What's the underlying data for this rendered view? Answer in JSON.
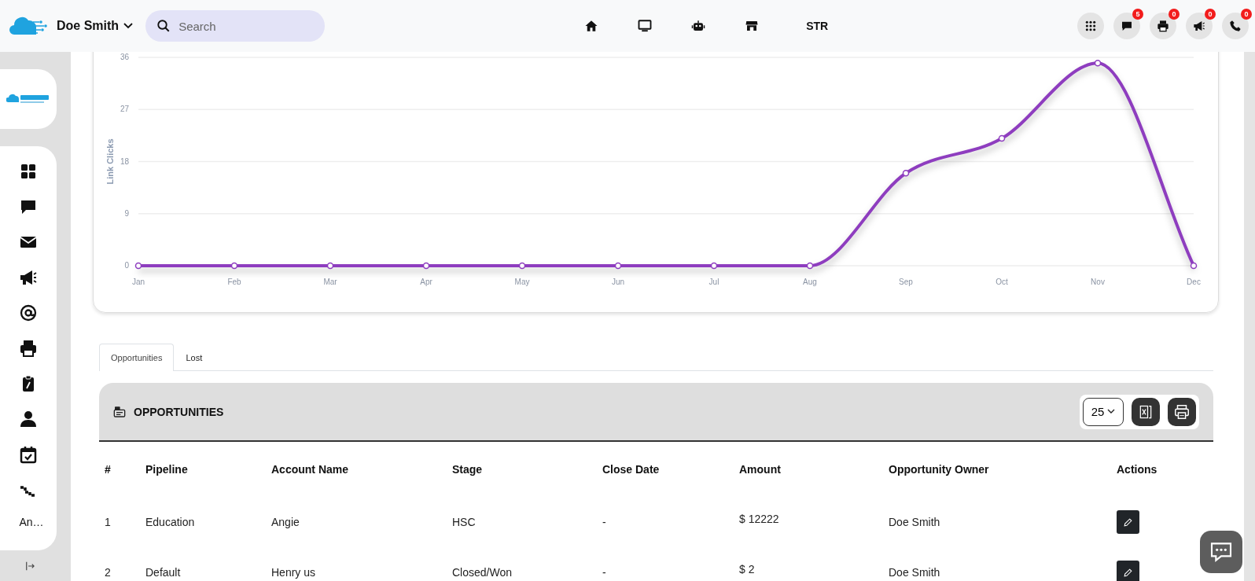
{
  "topbar": {
    "user": "Doe Smith",
    "search": {
      "placeholder": "Search"
    },
    "nav_label": "STR",
    "notifications": [
      {
        "count": "5"
      },
      {
        "count": "0"
      },
      {
        "count": "0"
      },
      {
        "count": "0"
      }
    ]
  },
  "sidebar": {
    "truncated_item": "An…"
  },
  "chart_data": {
    "type": "line",
    "ylabel": "Link Clicks",
    "categories": [
      "Jan",
      "Feb",
      "Mar",
      "Apr",
      "May",
      "Jun",
      "Jul",
      "Aug",
      "Sep",
      "Oct",
      "Nov",
      "Dec"
    ],
    "yticks": [
      0,
      9,
      18,
      27,
      36
    ],
    "ylim": [
      0,
      36
    ],
    "grid": true,
    "series": [
      {
        "color": "#8e3dbf",
        "marker": "circle",
        "values": [
          0,
          0,
          0,
          0,
          0,
          0,
          0,
          0,
          16,
          22,
          35,
          0
        ]
      }
    ]
  },
  "tabs": [
    {
      "label": "Opportunities",
      "selected": true
    },
    {
      "label": "Lost",
      "selected": false
    }
  ],
  "panel": {
    "title": "OPPORTUNITIES",
    "page_size": "25",
    "columns": [
      "#",
      "Pipeline",
      "Account Name",
      "Stage",
      "Close Date",
      "Amount",
      "Opportunity Owner",
      "Actions"
    ],
    "rows": [
      [
        "1",
        "Education",
        "Angie",
        "HSC",
        "-",
        "$ 12222",
        "Doe Smith"
      ],
      [
        "2",
        "Default",
        "Henry us",
        "Closed/Won",
        "-",
        "$ 2",
        "Doe Smith"
      ]
    ]
  }
}
